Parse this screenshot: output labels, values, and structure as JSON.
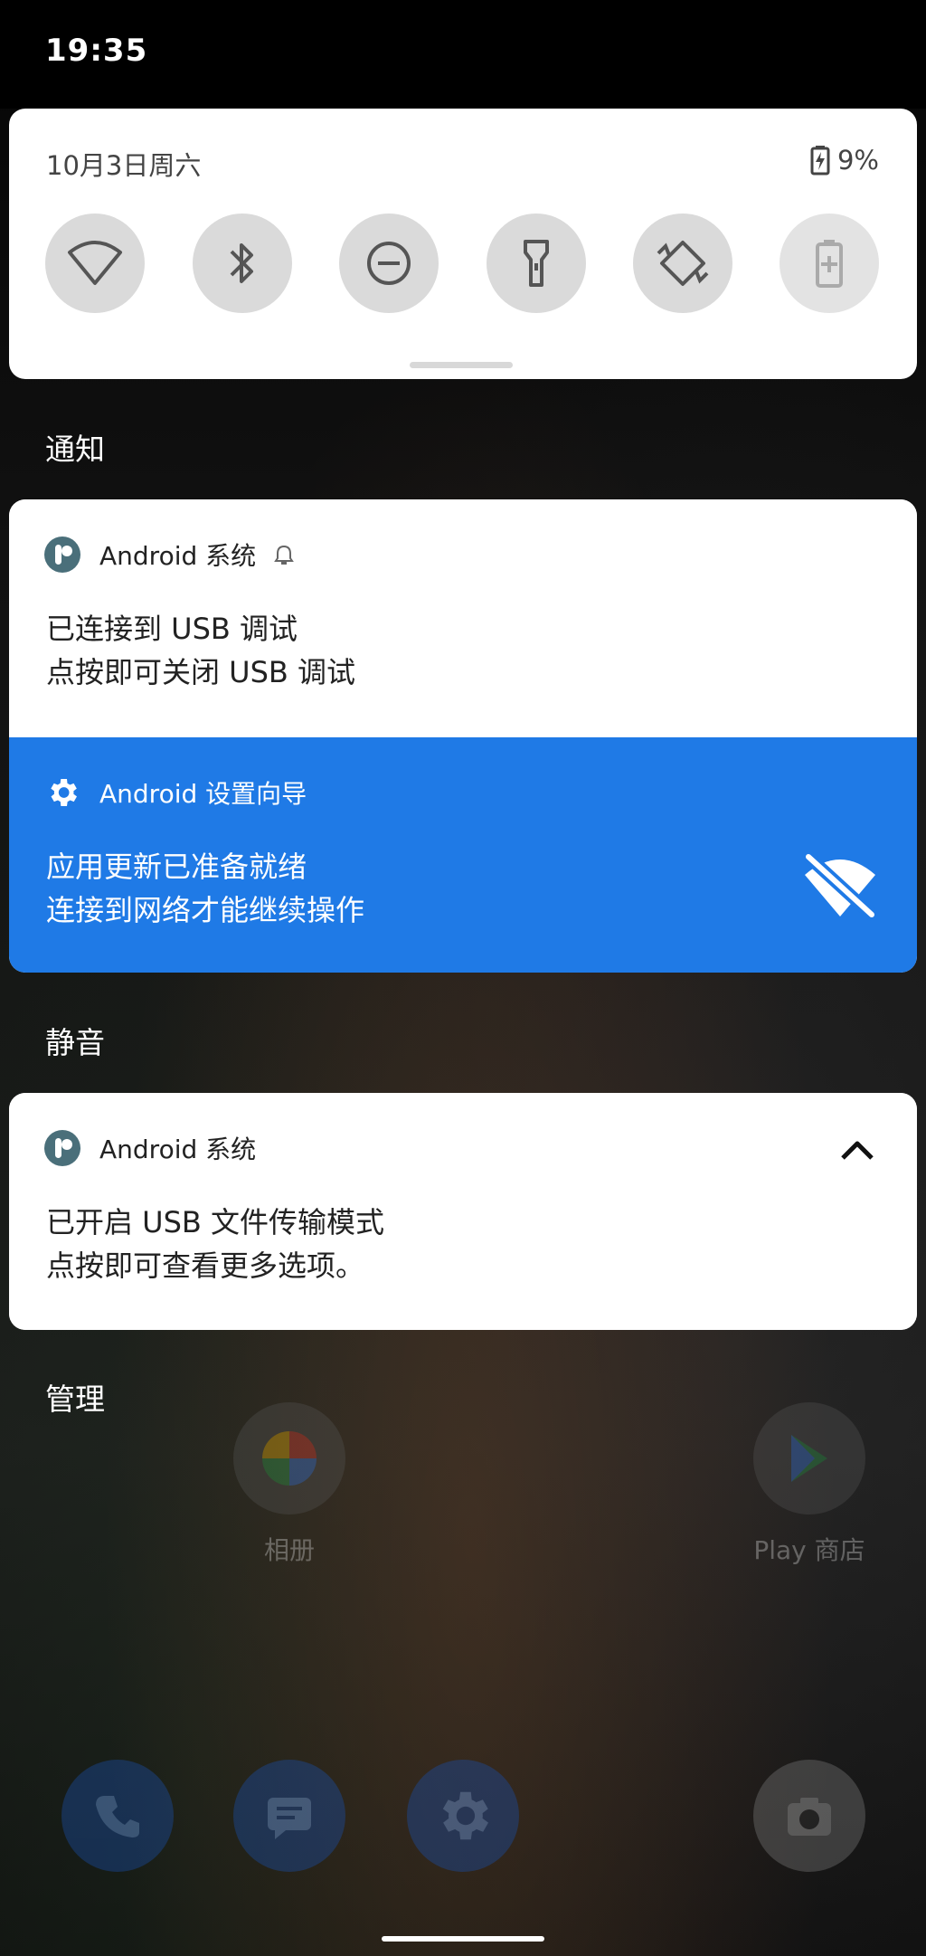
{
  "status_bar": {
    "time": "19:35"
  },
  "quick_settings": {
    "date": "10月3日周六",
    "battery_percent": "9%",
    "tiles": [
      {
        "icon": "wifi-icon",
        "active": false
      },
      {
        "icon": "bluetooth-icon",
        "active": false
      },
      {
        "icon": "do-not-disturb-icon",
        "active": false
      },
      {
        "icon": "flashlight-icon",
        "active": false
      },
      {
        "icon": "auto-rotate-icon",
        "active": false
      },
      {
        "icon": "battery-saver-icon",
        "active": false
      }
    ]
  },
  "sections": {
    "notifications_label": "通知",
    "silent_label": "静音",
    "manage_label": "管理"
  },
  "notifications": [
    {
      "app_name": "Android 系统",
      "title": "已连接到 USB 调试",
      "text": "点按即可关闭 USB 调试",
      "icon": "android-system-icon",
      "bell": true
    },
    {
      "app_name": "Android 设置向导",
      "title": "应用更新已准备就绪",
      "text": "连接到网络才能继续操作",
      "icon": "gear-icon",
      "accent": "#1f7ae6",
      "action_icon": "wifi-off-icon"
    }
  ],
  "silent_notifications": [
    {
      "app_name": "Android 系统",
      "title": "已开启 USB 文件传输模式",
      "text": "点按即可查看更多选项。",
      "icon": "android-system-icon",
      "expanded": true
    }
  ],
  "home_screen": {
    "apps": [
      {
        "label": "相册",
        "icon": "photos-icon"
      },
      {
        "label": "Play 商店",
        "icon": "play-store-icon"
      }
    ],
    "dock": [
      {
        "icon": "phone-icon"
      },
      {
        "icon": "messages-icon"
      },
      {
        "icon": "settings-icon"
      },
      {
        "icon": "camera-icon"
      }
    ]
  }
}
